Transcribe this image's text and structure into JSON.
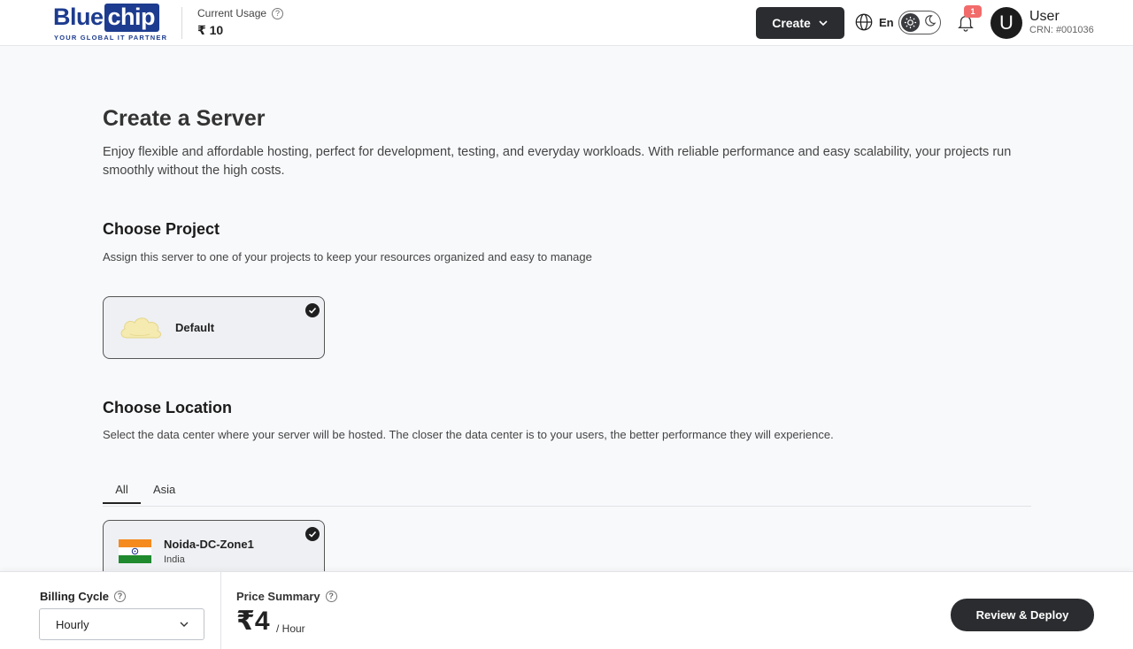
{
  "header": {
    "logo_word_a": "Blue",
    "logo_word_b": "chip",
    "logo_tagline": "YOUR GLOBAL IT PARTNER",
    "usage_label": "Current Usage",
    "usage_value": "₹ 10",
    "create_label": "Create",
    "language": "En",
    "notification_count": "1",
    "avatar_letter": "U",
    "user_name": "User",
    "user_crn": "CRN: #001036"
  },
  "main": {
    "title": "Create a Server",
    "description": "Enjoy flexible and affordable hosting, perfect for development, testing, and everyday workloads. With reliable performance and easy scalability, your projects run smoothly without the high costs.",
    "project_section": {
      "title": "Choose Project",
      "description": "Assign this server to one of your projects to keep your resources organized and easy to manage",
      "selected_project": "Default"
    },
    "location_section": {
      "title": "Choose Location",
      "description": "Select the data center where your server will be hosted. The closer the data center is to your users, the better performance they will experience.",
      "tabs": [
        "All",
        "Asia"
      ],
      "active_tab": "All",
      "selected_location": {
        "name": "Noida-DC-Zone1",
        "country": "India"
      }
    }
  },
  "footer": {
    "billing_label": "Billing Cycle",
    "billing_value": "Hourly",
    "price_label": "Price Summary",
    "price_value": "₹4",
    "price_unit": "/ Hour",
    "deploy_label": "Review & Deploy"
  },
  "colors": {
    "brand": "#1d3c8f",
    "dark_button": "#2a2c2f",
    "badge": "#f26b6b"
  }
}
